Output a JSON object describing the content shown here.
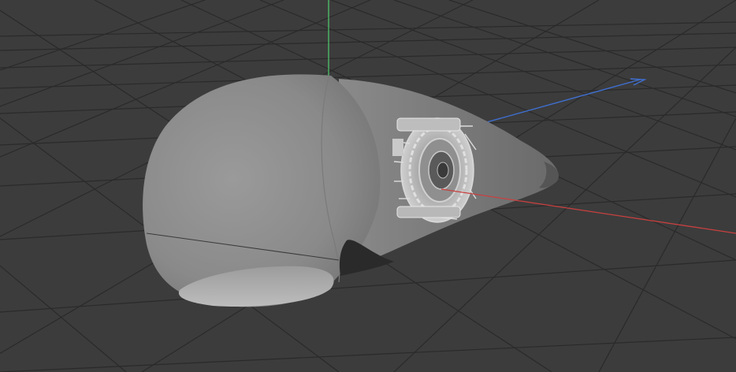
{
  "viewport": {
    "background": "#3c3c3c",
    "grid_color": "#2a2a2a",
    "axis_colors": {
      "x": "#c94040",
      "y": "#4fc36a",
      "z": "#3f6fd0"
    }
  },
  "object": {
    "body_color": "#8e8e8e",
    "part_color": "#b4b4b4"
  }
}
